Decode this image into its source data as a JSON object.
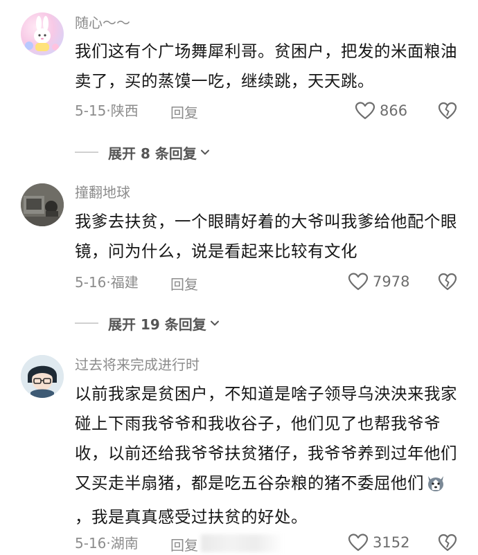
{
  "comments": [
    {
      "username": "随心～～",
      "text": "我们这有个广场舞犀利哥。贫困户，把发的米面粮油卖了，买的蒸馍一吃，继续跳，天天跳。",
      "meta": "5-15·陕西",
      "reply_label": "回复",
      "likes": "866",
      "expand_label": "展开 8 条回复"
    },
    {
      "username": "撞翻地球",
      "text": "我爹去扶贫，一个眼睛好着的大爷叫我爹给他配个眼镜，问为什么，说是看起来比较有文化",
      "meta": "5-16·福建",
      "reply_label": "回复",
      "likes": "7978",
      "expand_label": "展开 19 条回复"
    },
    {
      "username": "过去将来完成进行时",
      "text_before_emoji": "以前我家是贫困户，不知道是啥子领导乌泱泱来我家碰上下雨我爷爷和我收谷子，他们见了也帮我爷爷收，以前还给我爷爷扶贫猪仔，我爷爷养到过年他们又买走半扇猪，都是吃五谷杂粮的猪不委屈他们",
      "text_after_emoji": "，我是真真感受过扶贫的好处。",
      "emoji": "husky-dog-emoji",
      "meta": "5-16·湖南",
      "reply_label": "回复",
      "likes": "3152"
    }
  ],
  "icons": {
    "like": "heart-outline-icon",
    "dislike": "broken-heart-icon",
    "expand": "chevron-down-icon"
  }
}
